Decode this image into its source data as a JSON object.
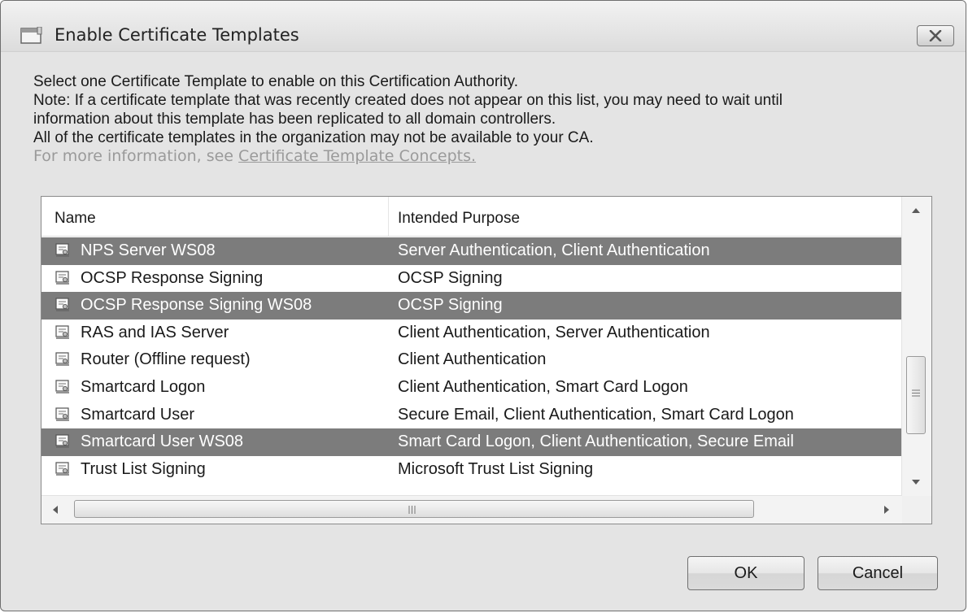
{
  "window": {
    "title": "Enable Certificate Templates",
    "close_glyph": "✕"
  },
  "description": {
    "line1": "Select one Certificate Template to enable on this Certification Authority.",
    "line2": "Note: If a certificate template that was recently created does not appear on this list, you may need to wait until",
    "line3": "information about this template has been replicated to all domain controllers.",
    "line4": "All of the certificate templates in the organization may not be available to your CA.",
    "more_prefix": "For more information, see ",
    "more_link": "Certificate Template Concepts."
  },
  "list": {
    "headers": {
      "name": "Name",
      "purpose": "Intended Purpose"
    },
    "rows": [
      {
        "name": "NPS Server WS08",
        "purpose": "Server Authentication, Client Authentication",
        "selected": true
      },
      {
        "name": "OCSP Response Signing",
        "purpose": "OCSP Signing",
        "selected": false
      },
      {
        "name": "OCSP Response Signing WS08",
        "purpose": "OCSP Signing",
        "selected": true
      },
      {
        "name": "RAS and IAS Server",
        "purpose": "Client Authentication, Server Authentication",
        "selected": false
      },
      {
        "name": "Router (Offline request)",
        "purpose": "Client Authentication",
        "selected": false
      },
      {
        "name": "Smartcard Logon",
        "purpose": "Client Authentication, Smart Card Logon",
        "selected": false
      },
      {
        "name": "Smartcard User",
        "purpose": "Secure Email, Client Authentication, Smart Card Logon",
        "selected": false
      },
      {
        "name": "Smartcard User WS08",
        "purpose": "Smart Card Logon, Client Authentication, Secure Email",
        "selected": true
      },
      {
        "name": "Trust List Signing",
        "purpose": "Microsoft Trust List Signing",
        "selected": false
      }
    ],
    "icon": "certificate-template-icon",
    "selected_color": "#7c7c7c"
  },
  "buttons": {
    "ok": "OK",
    "cancel": "Cancel"
  }
}
